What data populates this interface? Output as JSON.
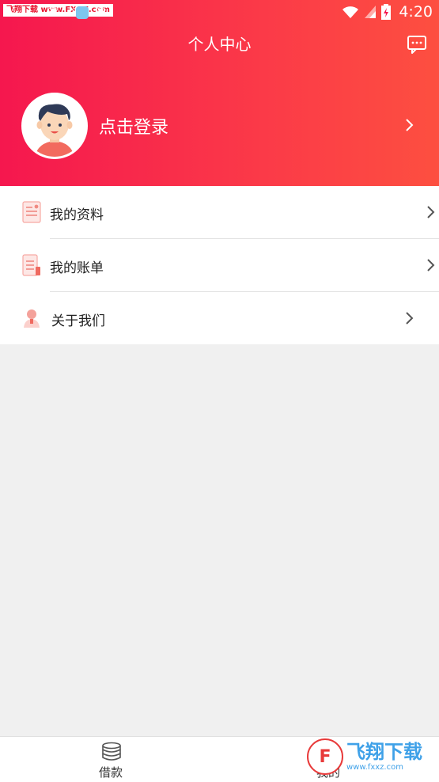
{
  "status_bar": {
    "watermark": "飞翔下载 www.FXXZ.com",
    "left_glyphs": "❀ ❀ ❀",
    "time": "4:20"
  },
  "header": {
    "title": "个人中心",
    "login_text": "点击登录"
  },
  "menu": [
    {
      "label": "我的资料",
      "icon": "profile-document-icon"
    },
    {
      "label": "我的账单",
      "icon": "bill-icon"
    },
    {
      "label": "关于我们",
      "icon": "about-person-icon"
    }
  ],
  "tabbar": {
    "tabs": [
      {
        "label": "借款",
        "icon": "coins-stack-icon"
      },
      {
        "label": "我的",
        "icon": "user-icon"
      }
    ]
  },
  "watermark_brand": {
    "title": "飞翔下载",
    "url": "www.fxxz.com"
  },
  "colors": {
    "header_gradient_start": "#f5174e",
    "header_gradient_end": "#fd4f40",
    "background": "#f0f0f0",
    "menu_icon_accent": "#f7a9a4"
  }
}
